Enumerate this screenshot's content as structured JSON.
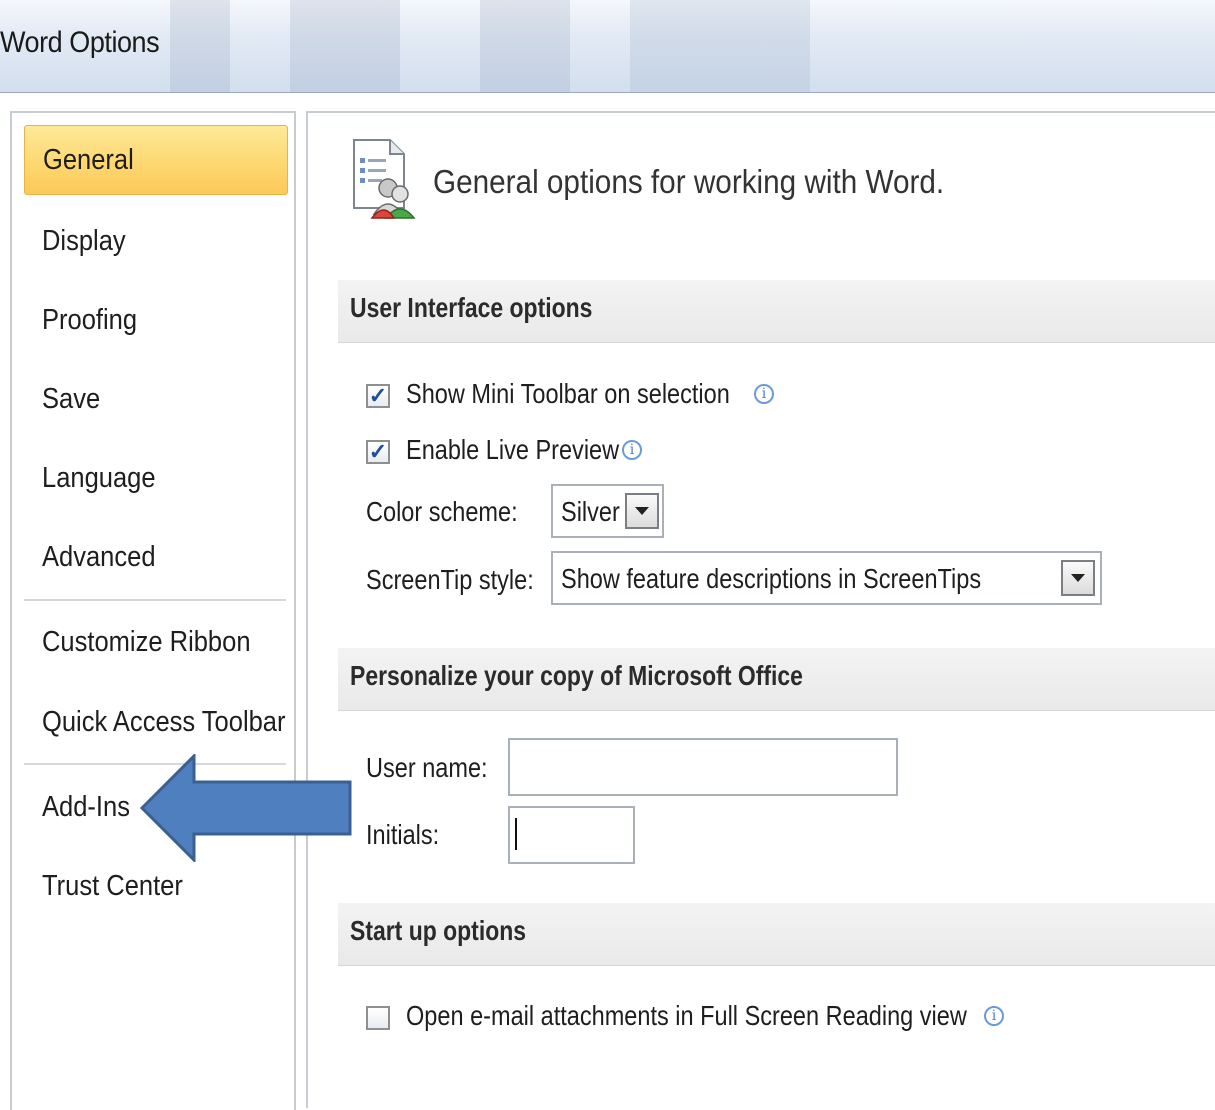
{
  "window": {
    "title": "Word Options"
  },
  "sidebar": {
    "items": [
      {
        "label": "General",
        "active": true
      },
      {
        "label": "Display"
      },
      {
        "label": "Proofing"
      },
      {
        "label": "Save"
      },
      {
        "label": "Language"
      },
      {
        "label": "Advanced"
      },
      {
        "label": "Customize Ribbon"
      },
      {
        "label": "Quick Access Toolbar"
      },
      {
        "label": "Add-Ins"
      },
      {
        "label": "Trust Center"
      }
    ]
  },
  "main": {
    "title": "General options for working with Word.",
    "sections": {
      "ui": {
        "header": "User Interface options",
        "mini_toolbar": {
          "label": "Show Mini Toolbar on selection",
          "checked": true
        },
        "live_preview": {
          "label": "Enable Live Preview",
          "checked": true
        },
        "color_scheme": {
          "label": "Color scheme:",
          "value": "Silver"
        },
        "screentip": {
          "label": "ScreenTip style:",
          "value": "Show feature descriptions in ScreenTips"
        }
      },
      "personalize": {
        "header": "Personalize your copy of Microsoft Office",
        "user_name": {
          "label": "User name:",
          "value": ""
        },
        "initials": {
          "label": "Initials:",
          "value": ""
        }
      },
      "startup": {
        "header": "Start up options",
        "full_screen": {
          "label": "Open e-mail attachments in Full Screen Reading view",
          "checked": false
        }
      }
    }
  },
  "icons": {
    "info": "i",
    "check": "✓"
  },
  "colors": {
    "active_nav": "#fdd870",
    "arrow_fill": "#4f7fbf",
    "arrow_stroke": "#3a5f90"
  }
}
